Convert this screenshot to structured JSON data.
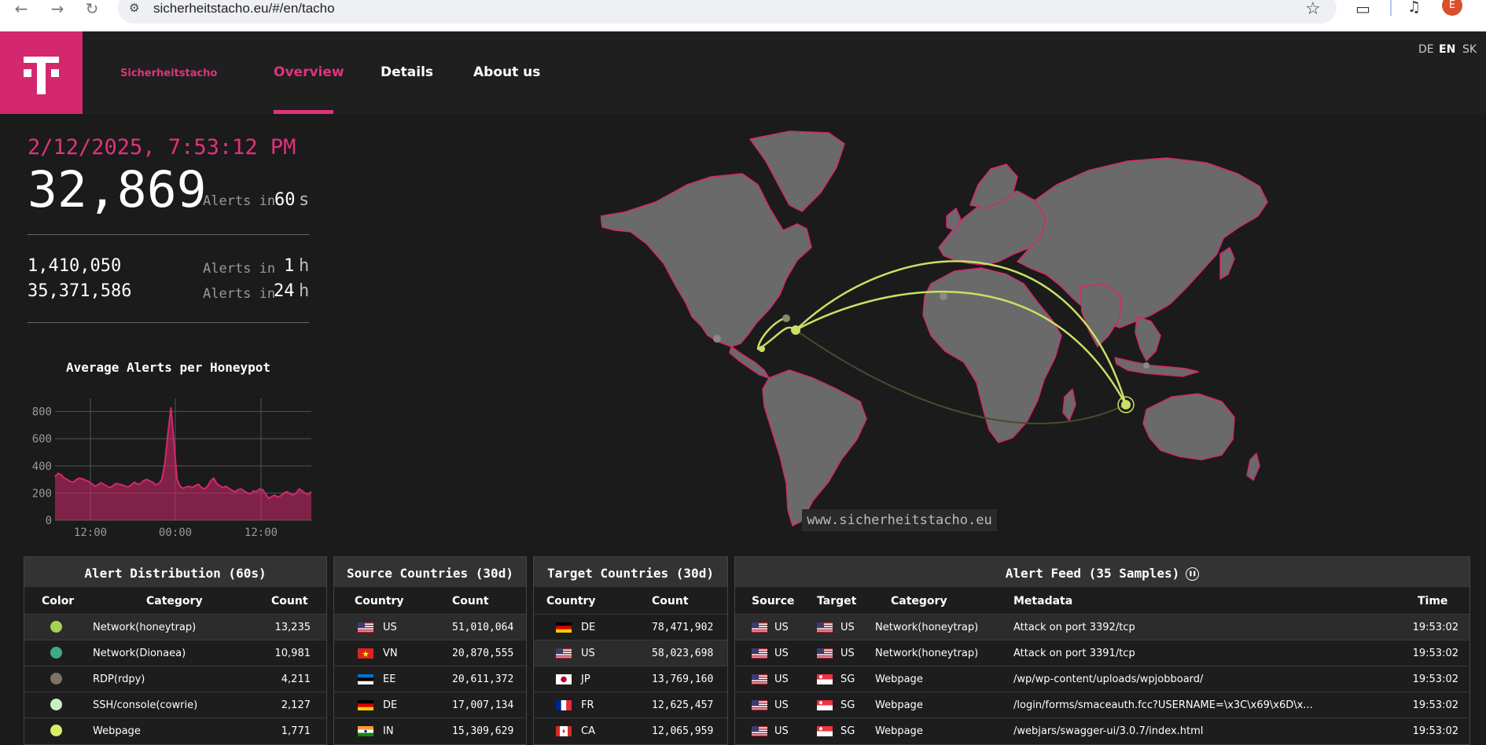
{
  "browser": {
    "url": "sicherheitstacho.eu/#/en/tacho",
    "profile_initial": "E"
  },
  "header": {
    "brand": "Sicherheitstacho",
    "logo_text": "T",
    "nav": [
      {
        "label": "Overview",
        "active": true
      },
      {
        "label": "Details",
        "active": false
      },
      {
        "label": "About us",
        "active": false
      }
    ],
    "languages": [
      {
        "code": "DE",
        "active": false
      },
      {
        "code": "EN",
        "active": true
      },
      {
        "code": "SK",
        "active": false
      }
    ]
  },
  "stats": {
    "timestamp": "2/12/2025, 7:53:12 PM",
    "count_60s": "32,869",
    "label": "Alerts in",
    "value_60s": "60",
    "unit_60s": "s",
    "count_1h": "1,410,050",
    "value_1h": "1",
    "unit_1h": "h",
    "count_24h": "35,371,586",
    "value_24h": "24",
    "unit_24h": "h"
  },
  "chart_data": {
    "type": "area",
    "title": "Average Alerts per Honeypot",
    "xlabel": "",
    "ylabel": "",
    "ylim": [
      0,
      850
    ],
    "yticks": [
      0,
      200,
      400,
      600,
      800
    ],
    "xticks": [
      "12:00",
      "00:00",
      "12:00"
    ],
    "grid": true,
    "color": "#d4286e",
    "values": [
      320,
      345,
      335,
      310,
      300,
      285,
      280,
      300,
      310,
      305,
      295,
      285,
      270,
      250,
      260,
      275,
      265,
      250,
      240,
      255,
      270,
      265,
      260,
      250,
      245,
      260,
      280,
      265,
      270,
      290,
      300,
      290,
      280,
      260,
      270,
      300,
      420,
      640,
      830,
      560,
      300,
      250,
      235,
      245,
      250,
      240,
      255,
      265,
      240,
      230,
      250,
      290,
      310,
      270,
      255,
      240,
      250,
      235,
      220,
      210,
      225,
      230,
      215,
      200,
      195,
      215,
      210,
      230,
      225,
      195,
      160,
      175,
      185,
      170,
      180,
      200,
      210,
      195,
      185,
      200,
      230,
      215,
      200,
      190,
      210
    ]
  },
  "map": {
    "watermark": "www.sicherheitstacho.eu"
  },
  "alert_distribution": {
    "title": "Alert Distribution (60s)",
    "columns": [
      "Color",
      "Category",
      "Count"
    ],
    "rows": [
      {
        "color": "#a6d153",
        "category": "Network(honeytrap)",
        "count": "13,235"
      },
      {
        "color": "#3fa98a",
        "category": "Network(Dionaea)",
        "count": "10,981"
      },
      {
        "color": "#7d7466",
        "category": "RDP(rdpy)",
        "count": "4,211"
      },
      {
        "color": "#c8efc0",
        "category": "SSH/console(cowrie)",
        "count": "2,127"
      },
      {
        "color": "#d6ef6a",
        "category": "Webpage",
        "count": "1,771"
      }
    ]
  },
  "source_countries": {
    "title": "Source Countries (30d)",
    "columns": [
      "Country",
      "Count"
    ],
    "rows": [
      {
        "flag": "us",
        "country": "US",
        "count": "51,010,064"
      },
      {
        "flag": "vn",
        "country": "VN",
        "count": "20,870,555"
      },
      {
        "flag": "ee",
        "country": "EE",
        "count": "20,611,372"
      },
      {
        "flag": "de",
        "country": "DE",
        "count": "17,007,134"
      },
      {
        "flag": "in",
        "country": "IN",
        "count": "15,309,629"
      }
    ]
  },
  "target_countries": {
    "title": "Target Countries (30d)",
    "columns": [
      "Country",
      "Count"
    ],
    "rows": [
      {
        "flag": "de",
        "country": "DE",
        "count": "78,471,902"
      },
      {
        "flag": "us",
        "country": "US",
        "count": "58,023,698"
      },
      {
        "flag": "jp",
        "country": "JP",
        "count": "13,769,160"
      },
      {
        "flag": "fr",
        "country": "FR",
        "count": "12,625,457"
      },
      {
        "flag": "ca",
        "country": "CA",
        "count": "12,065,959"
      }
    ]
  },
  "alert_feed": {
    "title": "Alert Feed (35 Samples)",
    "columns": [
      "Source",
      "Target",
      "Category",
      "Metadata",
      "Time"
    ],
    "rows": [
      {
        "src": "US",
        "src_flag": "us",
        "tgt": "US",
        "tgt_flag": "us",
        "category": "Network(honeytrap)",
        "metadata": "Attack on port 3392/tcp",
        "time": "19:53:02"
      },
      {
        "src": "US",
        "src_flag": "us",
        "tgt": "US",
        "tgt_flag": "us",
        "category": "Network(honeytrap)",
        "metadata": "Attack on port 3391/tcp",
        "time": "19:53:02"
      },
      {
        "src": "US",
        "src_flag": "us",
        "tgt": "SG",
        "tgt_flag": "sg",
        "category": "Webpage",
        "metadata": "/wp/wp-content/uploads/wpjobboard/",
        "time": "19:53:02"
      },
      {
        "src": "US",
        "src_flag": "us",
        "tgt": "SG",
        "tgt_flag": "sg",
        "category": "Webpage",
        "metadata": "/login/forms/smaceauth.fcc?USERNAME=\\x3C\\x69\\x6D\\x...",
        "time": "19:53:02"
      },
      {
        "src": "US",
        "src_flag": "us",
        "tgt": "SG",
        "tgt_flag": "sg",
        "category": "Webpage",
        "metadata": "/webjars/swagger-ui/3.0.7/index.html",
        "time": "19:53:02"
      }
    ]
  }
}
